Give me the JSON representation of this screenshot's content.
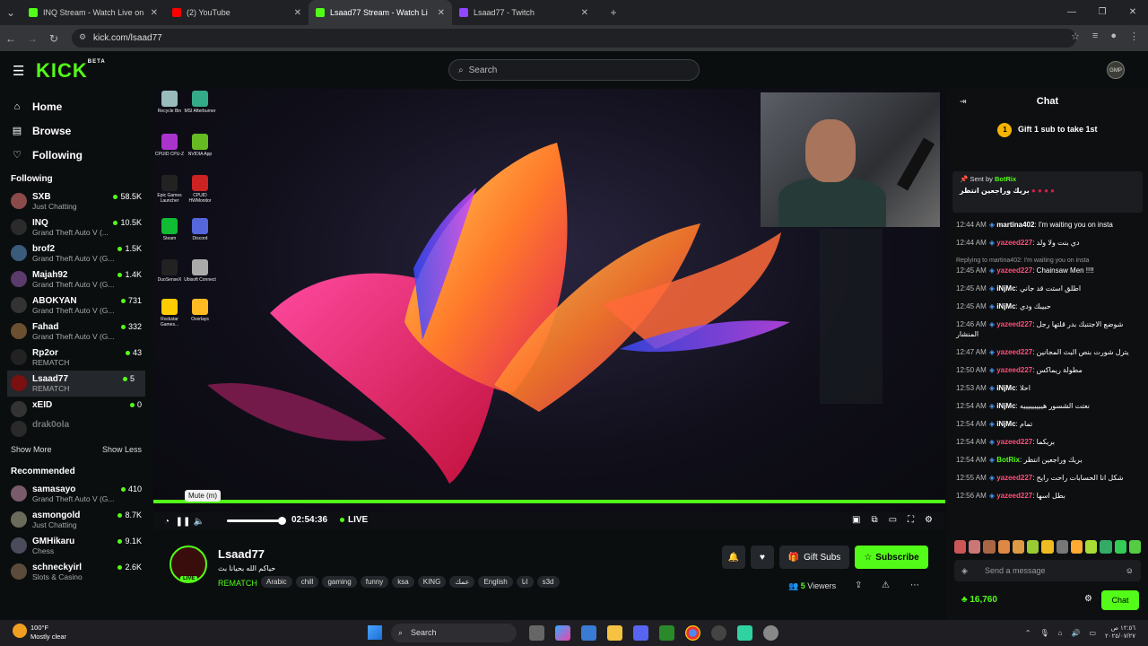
{
  "browser": {
    "tabs": [
      {
        "title": "INQ Stream - Watch Live on Ki",
        "color": "#53fc18",
        "active": false
      },
      {
        "title": "(2) YouTube",
        "color": "#ff0000",
        "active": false
      },
      {
        "title": "Lsaad77 Stream - Watch Li",
        "color": "#53fc18",
        "active": true
      },
      {
        "title": "Lsaad77 - Twitch",
        "color": "#9146ff",
        "active": false
      }
    ],
    "url": "kick.com/lsaad77"
  },
  "header": {
    "logo": "KICK",
    "logo_badge": "BETA",
    "search_placeholder": "Search",
    "avatar_text": "GMP"
  },
  "sidebar": {
    "nav": [
      {
        "label": "Home",
        "icon": "home-icon"
      },
      {
        "label": "Browse",
        "icon": "browse-icon"
      },
      {
        "label": "Following",
        "icon": "heart-icon"
      }
    ],
    "following_title": "Following",
    "following": [
      {
        "name": "SXB",
        "category": "Just Chatting",
        "viewers": "58.5K",
        "avatar_color": "#8b4a4a"
      },
      {
        "name": "INQ",
        "category": "Grand Theft Auto V (...",
        "viewers": "10.5K",
        "avatar_color": "#2b2b2b"
      },
      {
        "name": "brof2",
        "category": "Grand Theft Auto V (G...",
        "viewers": "1.5K",
        "avatar_color": "#3b5b7b"
      },
      {
        "name": "Majah92",
        "category": "Grand Theft Auto V (G...",
        "viewers": "1.4K",
        "avatar_color": "#5b3b6b"
      },
      {
        "name": "ABOKYAN",
        "category": "Grand Theft Auto V (G...",
        "viewers": "731",
        "avatar_color": "#333333"
      },
      {
        "name": "Fahad",
        "category": "Grand Theft Auto V (G...",
        "viewers": "332",
        "avatar_color": "#6b5030"
      },
      {
        "name": "Rp2or",
        "category": "REMATCH",
        "viewers": "43",
        "avatar_color": "#222222"
      },
      {
        "name": "Lsaad77",
        "category": "REMATCH",
        "viewers": "5",
        "avatar_color": "#7a1010"
      },
      {
        "name": "xEID",
        "category": "",
        "viewers": "0",
        "avatar_color": "#333333"
      },
      {
        "name": "drak0ola",
        "category": "",
        "viewers": "",
        "avatar_color": "#2a2a2a"
      }
    ],
    "show_more": "Show More",
    "show_less": "Show Less",
    "recommended_title": "Recommended",
    "recommended": [
      {
        "name": "samasayo",
        "category": "Grand Theft Auto V (G...",
        "viewers": "410",
        "avatar_color": "#7a5b6b"
      },
      {
        "name": "asmongold",
        "category": "Just Chatting",
        "viewers": "8.7K",
        "avatar_color": "#6b6b5b"
      },
      {
        "name": "GMHikaru",
        "category": "Chess",
        "viewers": "9.1K",
        "avatar_color": "#4b4b5b"
      },
      {
        "name": "schneckyirl",
        "category": "Slots & Casino",
        "viewers": "2.6K",
        "avatar_color": "#5b4b3b"
      }
    ]
  },
  "desktop_icons": [
    {
      "label": "Recycle Bin",
      "color": "#9bb"
    },
    {
      "label": "MSI Afterburner",
      "color": "#3a8"
    },
    {
      "label": "CPUID CPU-Z",
      "color": "#a3c"
    },
    {
      "label": "NVIDIA App",
      "color": "#6b2"
    },
    {
      "label": "Epic Games Launcher",
      "color": "#222"
    },
    {
      "label": "CPUID HWMonitor",
      "color": "#c22"
    },
    {
      "label": "Steam",
      "color": "#1b3"
    },
    {
      "label": "Discord",
      "color": "#56d"
    },
    {
      "label": "DuoSenseX",
      "color": "#222"
    },
    {
      "label": "Ubisoft Connect",
      "color": "#aaa"
    },
    {
      "label": "Rockstar Games...",
      "color": "#fc0"
    },
    {
      "label": "Overlays",
      "color": "#fb2"
    }
  ],
  "player": {
    "tooltip": "Mute (m)",
    "time": "02:54:36",
    "live": "LIVE",
    "volume": 0.95
  },
  "stream": {
    "name": "Lsaad77",
    "live_badge": "LIVE",
    "title": "حياكم الله بحيانا بث",
    "category": "REMATCH",
    "tags": [
      "Arabic",
      "chill",
      "gaming",
      "funny",
      "ksa",
      "KING",
      "عمك",
      "English",
      "انا",
      "s3d"
    ],
    "gift_subs": "Gift Subs",
    "subscribe": "Subscribe",
    "viewers_count": "5",
    "viewers_label": "Viewers"
  },
  "chat": {
    "title": "Chat",
    "gift_rank": "1",
    "gift_text": "Gift 1 sub to take 1st",
    "pinned_sent_by": "Sent by",
    "pinned_user": "BotRix",
    "pinned_msg": "بريك وراجعين انتظر",
    "messages": [
      {
        "time": "12:44 AM",
        "user": "martina402",
        "color": "#ffffff",
        "text": "I'm waiting you on insta",
        "reply": ""
      },
      {
        "time": "12:44 AM",
        "user": "yazeed227",
        "color": "#ff4f7a",
        "text": "دي بنت ولا ولد",
        "reply": ""
      },
      {
        "time": "12:45 AM",
        "user": "yazeed227",
        "color": "#ff4f7a",
        "text": "Chainsaw Men !!!!",
        "reply": "Replying to martina402: I'm waiting you on insta"
      },
      {
        "time": "12:45 AM",
        "user": "iNjMc",
        "color": "#ffffff",
        "text": "اطلق استت قد جاني",
        "reply": ""
      },
      {
        "time": "12:45 AM",
        "user": "iNjMc",
        "color": "#ffffff",
        "text": "حبيبك ودي",
        "reply": ""
      },
      {
        "time": "12:46 AM",
        "user": "yazeed227",
        "color": "#ff4f7a",
        "text": "شوضع الاجتنبك بدر قلتها رجل المنشار",
        "reply": ""
      },
      {
        "time": "12:47 AM",
        "user": "yazeed227",
        "color": "#ff4f7a",
        "text": "يترل شورت بنص البث المجانين",
        "reply": ""
      },
      {
        "time": "12:50 AM",
        "user": "yazeed227",
        "color": "#ff4f7a",
        "text": "مطولة ريماكس",
        "reply": ""
      },
      {
        "time": "12:53 AM",
        "user": "iNjMc",
        "color": "#ffffff",
        "text": "احلا",
        "reply": ""
      },
      {
        "time": "12:54 AM",
        "user": "iNjMc",
        "color": "#ffffff",
        "text": "نعتت الشسور هيييييييييه",
        "reply": ""
      },
      {
        "time": "12:54 AM",
        "user": "iNjMc",
        "color": "#ffffff",
        "text": "تمام",
        "reply": ""
      },
      {
        "time": "12:54 AM",
        "user": "yazeed227",
        "color": "#ff4f7a",
        "text": "بريكما",
        "reply": ""
      },
      {
        "time": "12:54 AM",
        "user": "BotRix",
        "color": "#53fc18",
        "text": "بريك وراجعين انتظر",
        "reply": ""
      },
      {
        "time": "12:55 AM",
        "user": "yazeed227",
        "color": "#ff4f7a",
        "text": "شكل انا الحسابات راحت رايح",
        "reply": ""
      },
      {
        "time": "12:56 AM",
        "user": "yazeed227",
        "color": "#ff4f7a",
        "text": "بطل اسها",
        "reply": ""
      }
    ],
    "input_placeholder": "Send a message",
    "points": "16,760",
    "chat_button": "Chat"
  },
  "taskbar": {
    "weather_temp": "100°F",
    "weather_desc": "Mostly clear",
    "search": "Search",
    "time": "١٢:٥٦ ص",
    "date": "٢٠٢٥/٠٧/٢٧"
  }
}
